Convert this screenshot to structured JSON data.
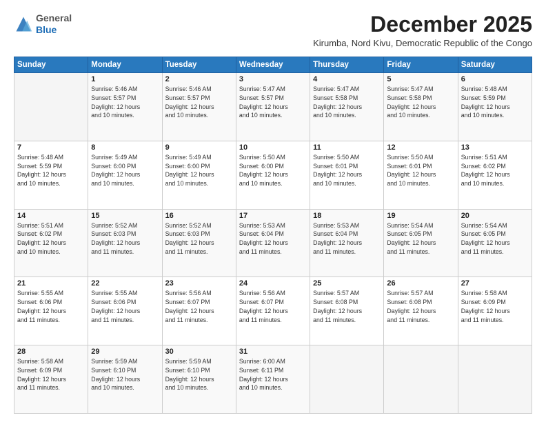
{
  "logo": {
    "general": "General",
    "blue": "Blue"
  },
  "header": {
    "month_year": "December 2025",
    "location": "Kirumba, Nord Kivu, Democratic Republic of the Congo"
  },
  "weekdays": [
    "Sunday",
    "Monday",
    "Tuesday",
    "Wednesday",
    "Thursday",
    "Friday",
    "Saturday"
  ],
  "weeks": [
    [
      {
        "day": "",
        "detail": ""
      },
      {
        "day": "1",
        "detail": "Sunrise: 5:46 AM\nSunset: 5:57 PM\nDaylight: 12 hours\nand 10 minutes."
      },
      {
        "day": "2",
        "detail": "Sunrise: 5:46 AM\nSunset: 5:57 PM\nDaylight: 12 hours\nand 10 minutes."
      },
      {
        "day": "3",
        "detail": "Sunrise: 5:47 AM\nSunset: 5:57 PM\nDaylight: 12 hours\nand 10 minutes."
      },
      {
        "day": "4",
        "detail": "Sunrise: 5:47 AM\nSunset: 5:58 PM\nDaylight: 12 hours\nand 10 minutes."
      },
      {
        "day": "5",
        "detail": "Sunrise: 5:47 AM\nSunset: 5:58 PM\nDaylight: 12 hours\nand 10 minutes."
      },
      {
        "day": "6",
        "detail": "Sunrise: 5:48 AM\nSunset: 5:59 PM\nDaylight: 12 hours\nand 10 minutes."
      }
    ],
    [
      {
        "day": "7",
        "detail": "Sunrise: 5:48 AM\nSunset: 5:59 PM\nDaylight: 12 hours\nand 10 minutes."
      },
      {
        "day": "8",
        "detail": "Sunrise: 5:49 AM\nSunset: 6:00 PM\nDaylight: 12 hours\nand 10 minutes."
      },
      {
        "day": "9",
        "detail": "Sunrise: 5:49 AM\nSunset: 6:00 PM\nDaylight: 12 hours\nand 10 minutes."
      },
      {
        "day": "10",
        "detail": "Sunrise: 5:50 AM\nSunset: 6:00 PM\nDaylight: 12 hours\nand 10 minutes."
      },
      {
        "day": "11",
        "detail": "Sunrise: 5:50 AM\nSunset: 6:01 PM\nDaylight: 12 hours\nand 10 minutes."
      },
      {
        "day": "12",
        "detail": "Sunrise: 5:50 AM\nSunset: 6:01 PM\nDaylight: 12 hours\nand 10 minutes."
      },
      {
        "day": "13",
        "detail": "Sunrise: 5:51 AM\nSunset: 6:02 PM\nDaylight: 12 hours\nand 10 minutes."
      }
    ],
    [
      {
        "day": "14",
        "detail": "Sunrise: 5:51 AM\nSunset: 6:02 PM\nDaylight: 12 hours\nand 10 minutes."
      },
      {
        "day": "15",
        "detail": "Sunrise: 5:52 AM\nSunset: 6:03 PM\nDaylight: 12 hours\nand 11 minutes."
      },
      {
        "day": "16",
        "detail": "Sunrise: 5:52 AM\nSunset: 6:03 PM\nDaylight: 12 hours\nand 11 minutes."
      },
      {
        "day": "17",
        "detail": "Sunrise: 5:53 AM\nSunset: 6:04 PM\nDaylight: 12 hours\nand 11 minutes."
      },
      {
        "day": "18",
        "detail": "Sunrise: 5:53 AM\nSunset: 6:04 PM\nDaylight: 12 hours\nand 11 minutes."
      },
      {
        "day": "19",
        "detail": "Sunrise: 5:54 AM\nSunset: 6:05 PM\nDaylight: 12 hours\nand 11 minutes."
      },
      {
        "day": "20",
        "detail": "Sunrise: 5:54 AM\nSunset: 6:05 PM\nDaylight: 12 hours\nand 11 minutes."
      }
    ],
    [
      {
        "day": "21",
        "detail": "Sunrise: 5:55 AM\nSunset: 6:06 PM\nDaylight: 12 hours\nand 11 minutes."
      },
      {
        "day": "22",
        "detail": "Sunrise: 5:55 AM\nSunset: 6:06 PM\nDaylight: 12 hours\nand 11 minutes."
      },
      {
        "day": "23",
        "detail": "Sunrise: 5:56 AM\nSunset: 6:07 PM\nDaylight: 12 hours\nand 11 minutes."
      },
      {
        "day": "24",
        "detail": "Sunrise: 5:56 AM\nSunset: 6:07 PM\nDaylight: 12 hours\nand 11 minutes."
      },
      {
        "day": "25",
        "detail": "Sunrise: 5:57 AM\nSunset: 6:08 PM\nDaylight: 12 hours\nand 11 minutes."
      },
      {
        "day": "26",
        "detail": "Sunrise: 5:57 AM\nSunset: 6:08 PM\nDaylight: 12 hours\nand 11 minutes."
      },
      {
        "day": "27",
        "detail": "Sunrise: 5:58 AM\nSunset: 6:09 PM\nDaylight: 12 hours\nand 11 minutes."
      }
    ],
    [
      {
        "day": "28",
        "detail": "Sunrise: 5:58 AM\nSunset: 6:09 PM\nDaylight: 12 hours\nand 11 minutes."
      },
      {
        "day": "29",
        "detail": "Sunrise: 5:59 AM\nSunset: 6:10 PM\nDaylight: 12 hours\nand 10 minutes."
      },
      {
        "day": "30",
        "detail": "Sunrise: 5:59 AM\nSunset: 6:10 PM\nDaylight: 12 hours\nand 10 minutes."
      },
      {
        "day": "31",
        "detail": "Sunrise: 6:00 AM\nSunset: 6:11 PM\nDaylight: 12 hours\nand 10 minutes."
      },
      {
        "day": "",
        "detail": ""
      },
      {
        "day": "",
        "detail": ""
      },
      {
        "day": "",
        "detail": ""
      }
    ]
  ]
}
